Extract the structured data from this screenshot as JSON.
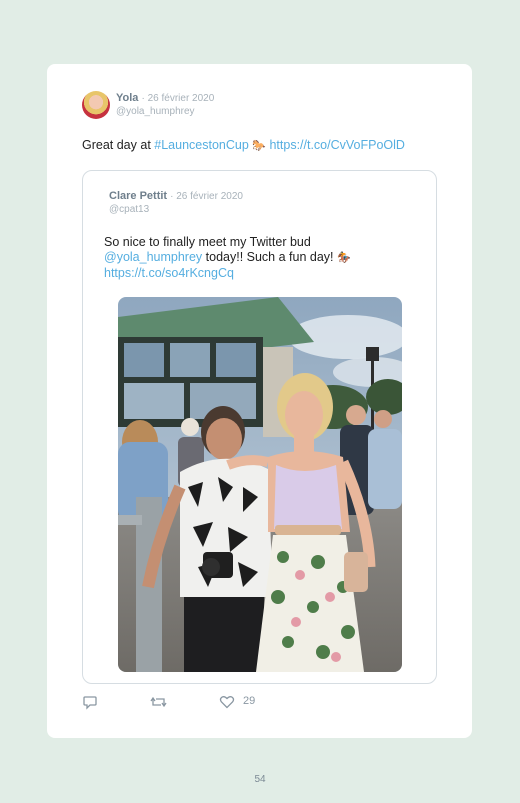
{
  "tweet": {
    "author_name": "Yola",
    "date": "· 26 février 2020",
    "handle": "@yola_humphrey",
    "text_prefix": "Great day at ",
    "hashtag": "#LauncestonCup",
    "emoji": "🐎",
    "link": "https://t.co/CvVoFPoOlD"
  },
  "quoted_tweet": {
    "author_name": "Clare Pettit",
    "date": "· 26 février 2020",
    "handle": "@cpat13",
    "text_line1": "So nice to finally meet my Twitter bud",
    "mention": "@yola_humphrey",
    "text_after_mention": " today!! Such a fun day! ",
    "emoji": "🏇",
    "link": "https://t.co/so4rKcngCq"
  },
  "actions": {
    "reply_icon": "reply-icon",
    "retweet_icon": "retweet-icon",
    "like_icon": "heart-icon",
    "like_count": "29"
  },
  "page": {
    "number": "54"
  },
  "colors": {
    "background": "#e1ede6",
    "card": "#ffffff",
    "link": "#55aee0"
  }
}
